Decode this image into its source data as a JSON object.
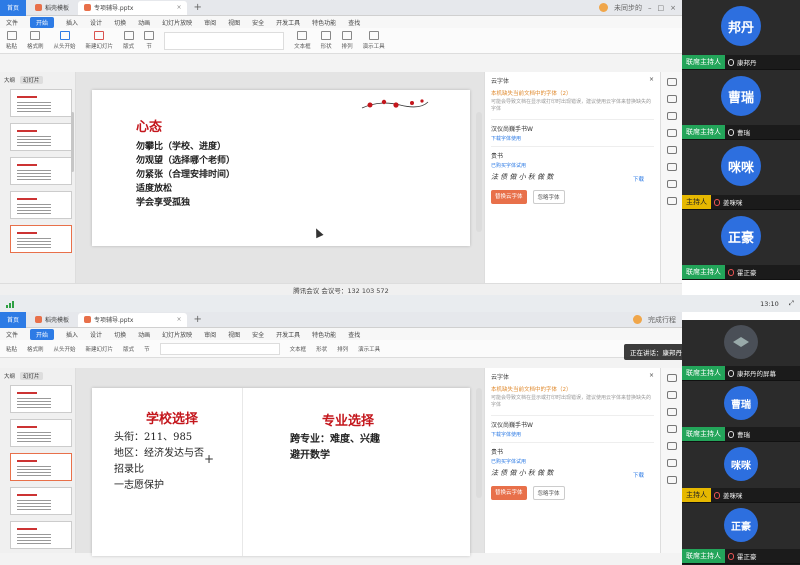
{
  "top_window": {
    "home_tab": "首页",
    "tabs": [
      {
        "label": "稻壳模板",
        "color": "#e8704a"
      },
      {
        "label": "专项辅导.pptx",
        "color": "#e8704a"
      }
    ],
    "account": "未同步的",
    "menus": [
      "文件",
      "开始",
      "插入",
      "设计",
      "切换",
      "动画",
      "幻灯片放映",
      "审阅",
      "视图",
      "安全",
      "开发工具",
      "特色功能",
      "查找"
    ],
    "ribbon": [
      "粘贴",
      "格式刷",
      "从头开始",
      "新建幻灯片",
      "版式",
      "节",
      "文本框",
      "形状",
      "排列",
      "演示工具"
    ],
    "thumb_header": [
      "大纲",
      "幻灯片"
    ],
    "slide": {
      "title": "心态",
      "lines": [
        "勿攀比（学校、进度）",
        "勿观望（选择哪个老师）",
        "勿紧张（合理安排时间）",
        "适度放松",
        "学会享受孤独"
      ]
    },
    "font_panel": {
      "header": "云字体",
      "notice": "本机缺失当前文档中的字体（2）",
      "desc": "可能会导致文档在显示或打印时出现错误，建议使用云字体来替换缺失的字体",
      "fonts": [
        {
          "name": "汉仪尚巍手书W",
          "link": "下载字体使用",
          "sample": ""
        },
        {
          "name": "贵书",
          "link": "已购买字体试用",
          "sample": "法 债 做 小 秋 做 数"
        }
      ],
      "download": "下载",
      "btn_primary": "替换云字体",
      "btn_secondary": "忽略字体"
    },
    "status": "腾讯会议 会议号：132 103 572"
  },
  "gap_strip": {
    "time": "13:10"
  },
  "bottom_window": {
    "home_tab": "首页",
    "tabs": [
      {
        "label": "稻壳模板",
        "color": "#e8704a"
      },
      {
        "label": "专项辅导.pptx",
        "color": "#e8704a"
      }
    ],
    "account": "完成行程",
    "menus": [
      "文件",
      "开始",
      "插入",
      "设计",
      "切换",
      "动画",
      "幻灯片放映",
      "审阅",
      "视图",
      "安全",
      "开发工具",
      "特色功能",
      "查找"
    ],
    "ribbon": [
      "粘贴",
      "格式刷",
      "从头开始",
      "新建幻灯片",
      "版式",
      "节",
      "文本框",
      "形状",
      "排列",
      "演示工具"
    ],
    "thumb_header": [
      "大纲",
      "幻灯片"
    ],
    "slide": {
      "left_title": "学校选择",
      "left_lines": [
        "头衔：211、985",
        "地区：经济发达与否",
        "招录比",
        "一志愿保护"
      ],
      "right_title": "专业选择",
      "right_lines": [
        "跨专业：难度、兴趣",
        "避开数学"
      ]
    },
    "font_panel": {
      "header": "云字体",
      "notice": "本机缺失当前文档中的字体（2）",
      "desc": "可能会导致文档在显示或打印时出现错误，建议使用云字体来替换缺失的字体",
      "fonts": [
        {
          "name": "汉仪尚巍手书W",
          "link": "下载字体使用",
          "sample": ""
        },
        {
          "name": "贵书",
          "link": "已购买字体试用",
          "sample": "法 债 做 小 秋 做 数"
        }
      ],
      "download": "下载",
      "btn_primary": "替换云字体",
      "btn_secondary": "忽略字体"
    }
  },
  "meeting_top": {
    "participants": [
      {
        "avatar": "邦丹",
        "role": "联席主持人",
        "role_color": "green",
        "name": "康邦丹"
      },
      {
        "avatar": "曹瑞",
        "role": "联席主持人",
        "role_color": "green",
        "name": "曹瑞"
      },
      {
        "avatar": "咪咪",
        "role": "主持人",
        "role_color": "yellow",
        "name": "姜咪咪"
      },
      {
        "avatar": "正豪",
        "role": "联席主持人",
        "role_color": "green",
        "name": "霍正豪"
      }
    ]
  },
  "meeting_bottom": {
    "speaking": "正在讲话：康邦丹",
    "participants": [
      {
        "avatar": "",
        "role": "联席主持人",
        "role_color": "green",
        "name": "康邦丹的屏幕"
      },
      {
        "avatar": "曹瑞",
        "role": "联席主持人",
        "role_color": "green",
        "name": "曹瑞"
      },
      {
        "avatar": "咪咪",
        "role": "主持人",
        "role_color": "yellow",
        "name": "姜咪咪"
      },
      {
        "avatar": "正豪",
        "role": "联席主持人",
        "role_color": "green",
        "name": "霍正豪"
      }
    ]
  }
}
